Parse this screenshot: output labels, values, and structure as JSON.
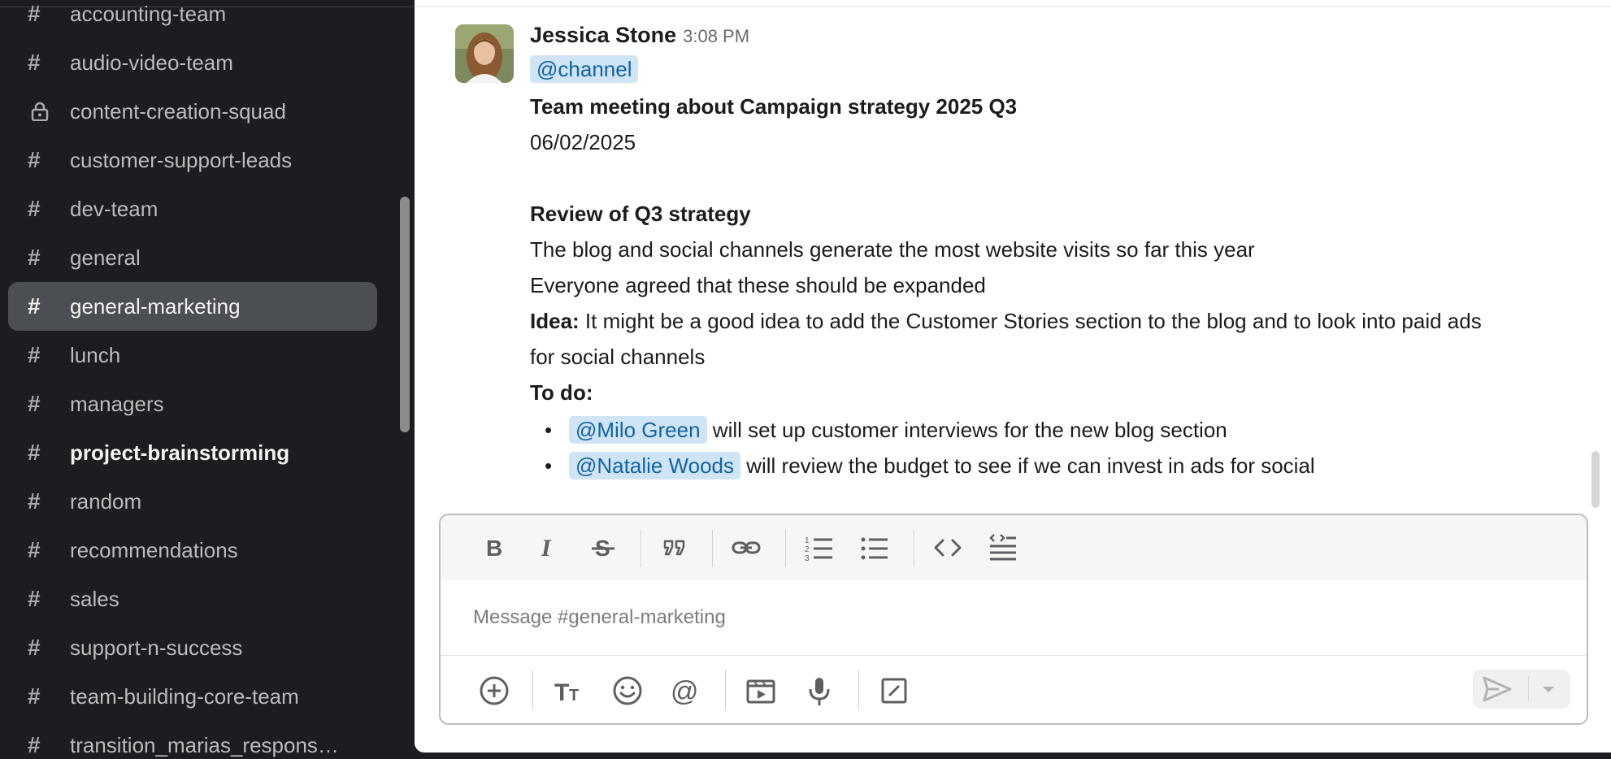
{
  "sidebar": {
    "channels": [
      {
        "name": "accounting-team",
        "icon": "hash-icon"
      },
      {
        "name": "audio-video-team",
        "icon": "hash-icon"
      },
      {
        "name": "content-creation-squad",
        "icon": "lock-icon"
      },
      {
        "name": "customer-support-leads",
        "icon": "hash-icon"
      },
      {
        "name": "dev-team",
        "icon": "hash-icon"
      },
      {
        "name": "general",
        "icon": "hash-icon"
      },
      {
        "name": "general-marketing",
        "icon": "hash-icon",
        "active": true
      },
      {
        "name": "lunch",
        "icon": "hash-icon"
      },
      {
        "name": "managers",
        "icon": "hash-icon"
      },
      {
        "name": "project-brainstorming",
        "icon": "hash-icon",
        "unread": true
      },
      {
        "name": "random",
        "icon": "hash-icon"
      },
      {
        "name": "recommendations",
        "icon": "hash-icon"
      },
      {
        "name": "sales",
        "icon": "hash-icon"
      },
      {
        "name": "support-n-success",
        "icon": "hash-icon"
      },
      {
        "name": "team-building-core-team",
        "icon": "hash-icon"
      },
      {
        "name": "transition_marias_respons…",
        "icon": "hash-icon"
      }
    ]
  },
  "message": {
    "author": "Jessica Stone",
    "time": "3:08 PM",
    "channel_mention": "@channel",
    "title": "Team meeting about Campaign strategy 2025 Q3",
    "date": "06/02/2025",
    "section_heading": "Review of Q3 strategy",
    "line1": "The blog and social channels generate the most website visits so far this year",
    "line2": "Everyone agreed that these should be expanded",
    "idea_label": "Idea:",
    "idea_text": " It might be a good idea to add the Customer Stories section to the blog and to look into paid ads",
    "idea_text_cont": "for social channels",
    "todo_label": "To do:",
    "todos": [
      {
        "mention": "@Milo Green",
        "text": " will set up customer interviews for the new blog section"
      },
      {
        "mention": "@Natalie Woods",
        "text": " will review the budget to see if we can invest in ads for social"
      }
    ]
  },
  "composer": {
    "placeholder": "Message #general-marketing",
    "toolbar": [
      "bold-icon",
      "italic-icon",
      "strikethrough-icon",
      "quote-icon",
      "link-icon",
      "ordered-list-icon",
      "bullet-list-icon",
      "code-icon",
      "code-block-icon"
    ],
    "bottom": [
      "attach-plus-icon",
      "formatting-icon",
      "emoji-icon",
      "mention-icon",
      "video-clip-icon",
      "microphone-icon",
      "slash-command-icon"
    ]
  },
  "colors": {
    "sidebar_bg": "#1b1d21",
    "active_item": "#4b4f54",
    "mention_bg": "#cfe4f5",
    "mention_text": "#1264a3"
  }
}
